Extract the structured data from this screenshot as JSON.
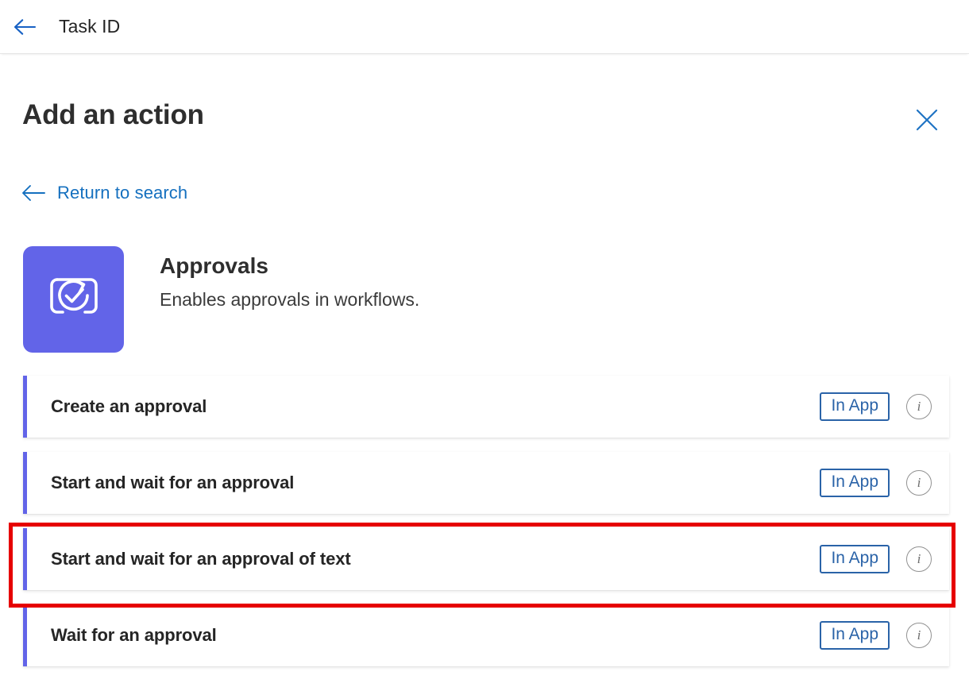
{
  "topbar": {
    "back_icon": "arrow-left-icon",
    "title": "Task ID"
  },
  "panel": {
    "title": "Add an action",
    "close_icon": "close-icon",
    "return_link": {
      "icon": "arrow-left-icon",
      "label": "Return to search"
    }
  },
  "connector": {
    "icon_name": "approvals-connector-icon",
    "icon_color": "#6264e8",
    "name": "Approvals",
    "description": "Enables approvals in workflows."
  },
  "actions": [
    {
      "label": "Create an approval",
      "badge": "In App",
      "info_icon": "info-icon",
      "highlighted": false
    },
    {
      "label": "Start and wait for an approval",
      "badge": "In App",
      "info_icon": "info-icon",
      "highlighted": false
    },
    {
      "label": "Start and wait for an approval of text",
      "badge": "In App",
      "info_icon": "info-icon",
      "highlighted": true
    },
    {
      "label": "Wait for an approval",
      "badge": "In App",
      "info_icon": "info-icon",
      "highlighted": false
    }
  ],
  "colors": {
    "accent_purple": "#6264e8",
    "link_blue": "#1570bf",
    "badge_blue": "#2a63a8",
    "annotation_red": "#e60000"
  }
}
